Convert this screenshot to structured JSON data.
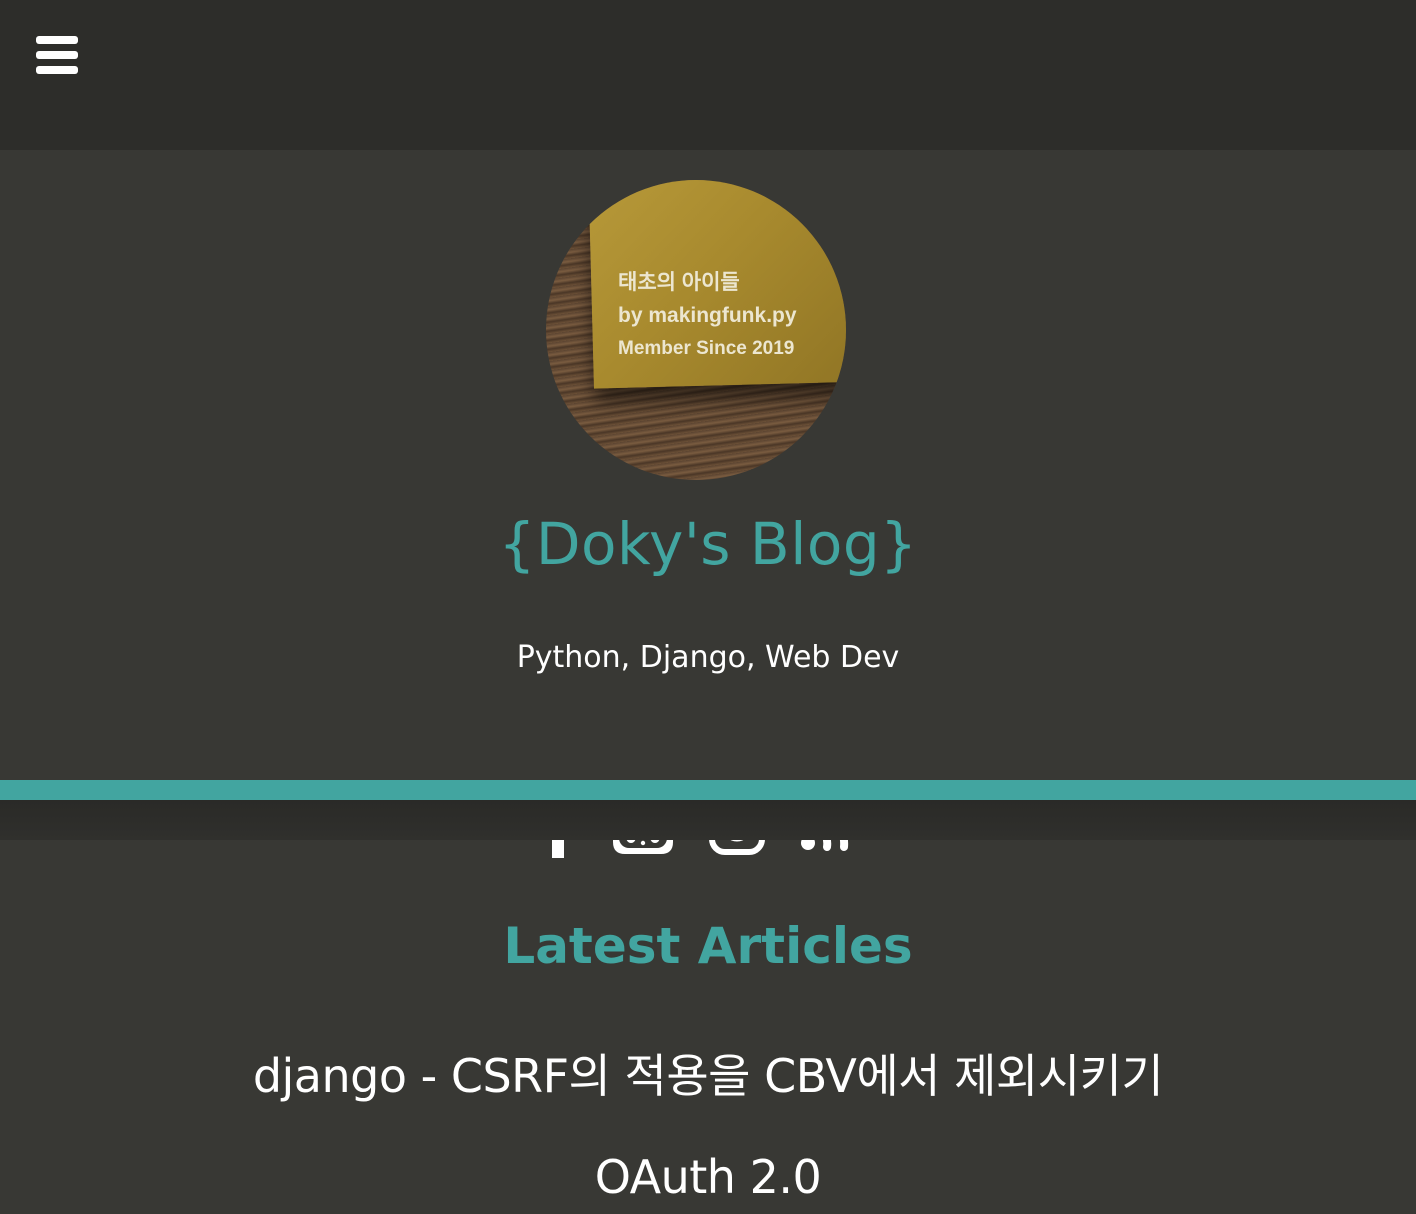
{
  "header": {
    "menu_icon": "hamburger-menu-icon"
  },
  "profile": {
    "avatar_text": [
      "태초의 아이들",
      "by makingfunk.py",
      "Member Since 2019"
    ]
  },
  "blog": {
    "title": "{Doky's Blog}",
    "tagline": "Python, Django, Web Dev"
  },
  "social_links": [
    {
      "icon": "facebook-icon"
    },
    {
      "icon": "github-icon"
    },
    {
      "icon": "instagram-icon"
    },
    {
      "icon": "rss-icon"
    }
  ],
  "latest": {
    "heading": "Latest Articles",
    "articles": [
      {
        "title": "django - CSRF의 적용을 CBV에서 제외시키기"
      },
      {
        "title": "OAuth 2.0"
      }
    ]
  },
  "colors": {
    "accent": "#42a5a0",
    "background": "#383834",
    "topbar": "#2d2d2a",
    "text": "#ffffff"
  }
}
